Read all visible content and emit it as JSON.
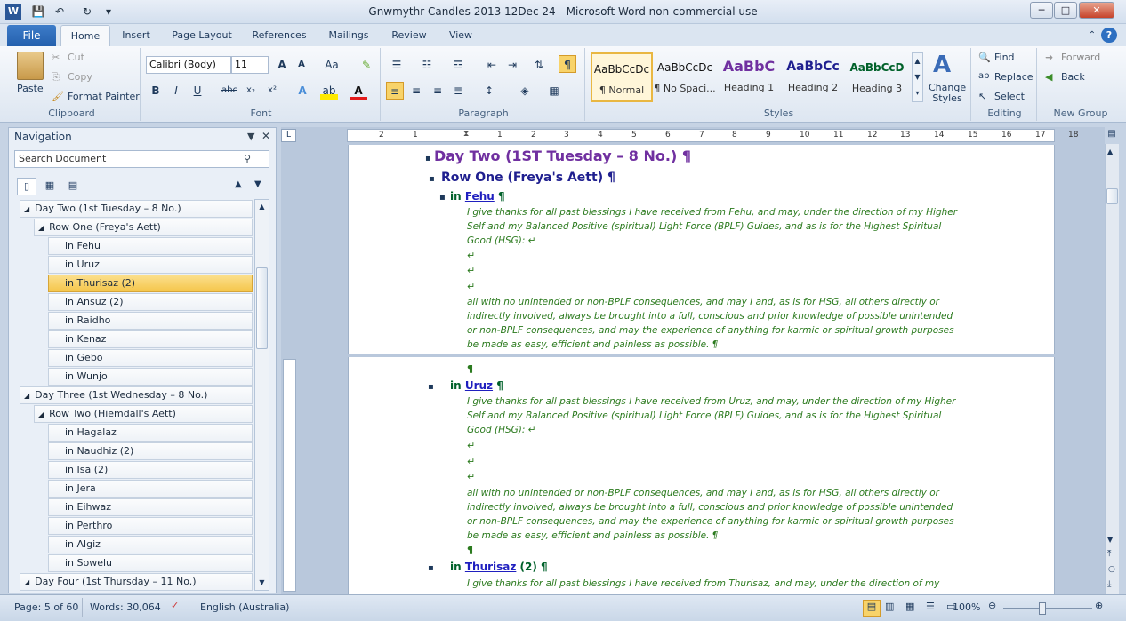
{
  "window": {
    "title": "Gnwmythr Candles 2013 12Dec 24  -  Microsoft Word non-commercial use"
  },
  "qat": {
    "app_icon": "word-icon",
    "save": "💾",
    "undo": "↶",
    "redo": "↻",
    "customize": "▾"
  },
  "window_controls": {
    "minimize": "─",
    "maximize": "□",
    "close": "✕"
  },
  "tabs": {
    "file": "File",
    "home": "Home",
    "insert": "Insert",
    "page_layout": "Page Layout",
    "references": "References",
    "mailings": "Mailings",
    "review": "Review",
    "view": "View"
  },
  "ribbon": {
    "clipboard": {
      "paste": "Paste",
      "cut": "Cut",
      "copy": "Copy",
      "format_painter": "Format Painter",
      "label": "Clipboard"
    },
    "font": {
      "family": "Calibri (Body)",
      "size": "11",
      "label": "Font"
    },
    "paragraph": {
      "label": "Paragraph"
    },
    "styles": {
      "label": "Styles",
      "items": [
        {
          "sample": "AaBbCcDc",
          "name": "¶ Normal"
        },
        {
          "sample": "AaBbCcDc",
          "name": "¶ No Spaci..."
        },
        {
          "sample": "AaBbC",
          "name": "Heading 1"
        },
        {
          "sample": "AaBbCc",
          "name": "Heading 2"
        },
        {
          "sample": "AaBbCcD",
          "name": "Heading 3"
        }
      ],
      "change_styles": "Change Styles"
    },
    "editing": {
      "find": "Find",
      "replace": "Replace",
      "select": "Select",
      "label": "Editing"
    },
    "new_group": {
      "forward": "Forward",
      "back": "Back",
      "label": "New Group"
    }
  },
  "navigation": {
    "title": "Navigation",
    "search_placeholder": "Search Document",
    "items": [
      {
        "text": "Day Two (1st Tuesday – 8 No.)",
        "level": 1,
        "selected": false
      },
      {
        "text": "Row One (Freya's Aett)",
        "level": 2,
        "selected": false
      },
      {
        "text": "in Fehu",
        "level": 3,
        "selected": false
      },
      {
        "text": "in Uruz",
        "level": 3,
        "selected": false
      },
      {
        "text": "in Thurisaz (2)",
        "level": 3,
        "selected": true
      },
      {
        "text": "in Ansuz (2)",
        "level": 3,
        "selected": false
      },
      {
        "text": "in Raidho",
        "level": 3,
        "selected": false
      },
      {
        "text": "in Kenaz",
        "level": 3,
        "selected": false
      },
      {
        "text": "in Gebo",
        "level": 3,
        "selected": false
      },
      {
        "text": "in Wunjo",
        "level": 3,
        "selected": false
      },
      {
        "text": "Day Three (1st Wednesday – 8 No.)",
        "level": 1,
        "selected": false
      },
      {
        "text": "Row Two (Hiemdall's Aett)",
        "level": 2,
        "selected": false
      },
      {
        "text": "in Hagalaz",
        "level": 3,
        "selected": false
      },
      {
        "text": "in Naudhiz (2)",
        "level": 3,
        "selected": false
      },
      {
        "text": "in Isa (2)",
        "level": 3,
        "selected": false
      },
      {
        "text": "in Jera",
        "level": 3,
        "selected": false
      },
      {
        "text": "in Eihwaz",
        "level": 3,
        "selected": false
      },
      {
        "text": "in Perthro",
        "level": 3,
        "selected": false
      },
      {
        "text": "in Algiz",
        "level": 3,
        "selected": false
      },
      {
        "text": "in Sowelu",
        "level": 3,
        "selected": false
      },
      {
        "text": "Day Four (1st Thursday – 11 No.)",
        "level": 1,
        "selected": false
      }
    ]
  },
  "ruler": {
    "numbers": [
      "2",
      "1",
      "1",
      "2",
      "3",
      "4",
      "5",
      "6",
      "7",
      "8",
      "9",
      "10",
      "11",
      "12",
      "13",
      "14",
      "15",
      "16",
      "17",
      "18"
    ]
  },
  "document": {
    "heading1": "Day Two (1ST Tuesday – 8 No.) ¶",
    "heading2": "Row One (Freya's Aett) ¶",
    "fehu": {
      "prefix": "in ",
      "rune": "Fehu",
      "mark": " ¶"
    },
    "fehu_body1": "I give thanks for all past blessings I have received from Fehu, and may, under the direction of my Higher",
    "fehu_body2": "Self and my Balanced Positive (spiritual) Light Force (BPLF) Guides, and as is for the Highest Spiritual",
    "fehu_body3": "Good (HSG): ↵",
    "return": "↵",
    "fehu_body4": "all with no unintended or non-BPLF consequences, and may I and, as is for HSG, all others directly or",
    "fehu_body5": "indirectly involved, always be brought into a full, conscious and prior knowledge of possible unintended",
    "fehu_body6": "or non-BPLF consequences, and may the experience of anything for karmic or spiritual growth purposes",
    "fehu_body7": "be made as easy, efficient and painless as possible. ¶",
    "pilcrow": "¶",
    "uruz": {
      "prefix": "in ",
      "rune": "Uruz",
      "mark": " ¶"
    },
    "uruz_body1": "I give thanks for all past blessings I have received from Uruz, and may, under the direction of my Higher",
    "uruz_body2": "Self and my Balanced Positive (spiritual) Light Force (BPLF) Guides, and as is for the Highest Spiritual",
    "uruz_body3": "Good (HSG): ↵",
    "uruz_body4": "all with no unintended or non-BPLF consequences, and may I and, as is for HSG, all others directly or",
    "uruz_body5": "indirectly involved, always be brought into a full, conscious and prior knowledge of possible unintended",
    "uruz_body6": "or non-BPLF consequences, and may the experience of anything for karmic or spiritual growth purposes",
    "uruz_body7": "be made as easy, efficient and painless as possible. ¶",
    "thurisaz": {
      "prefix": "in ",
      "rune": "Thurisaz",
      "mark": " (2) ¶"
    },
    "thurisaz_body1": "I give thanks for all past blessings I have received from Thurisaz, and may, under the direction of my"
  },
  "status": {
    "page": "Page: 5 of 60",
    "words": "Words: 30,064",
    "language": "English (Australia)",
    "zoom": "100%"
  }
}
